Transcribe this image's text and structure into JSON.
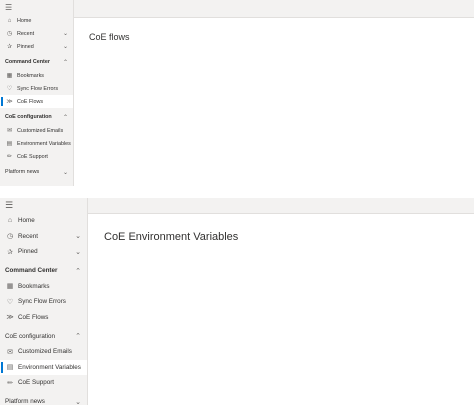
{
  "panels": [
    {
      "title": "CoE flows",
      "nav": {
        "home": "Home",
        "recent": "Recent",
        "pinned": "Pinned",
        "command_center": "Command Center",
        "bookmarks": "Bookmarks",
        "sync_flow_errors": "Sync Flow Errors",
        "coe_flows": "CoE Flows",
        "coe_configuration": "CoE configuration",
        "customized_emails": "Customized Emails",
        "environment_variables": "Environment Variables",
        "coe_support": "CoE Support",
        "platform_news": "Platform news"
      },
      "selected": "CoE Flows"
    },
    {
      "title": "CoE Environment Variables",
      "nav": {
        "home": "Home",
        "recent": "Recent",
        "pinned": "Pinned",
        "command_center": "Command Center",
        "bookmarks": "Bookmarks",
        "sync_flow_errors": "Sync Flow Errors",
        "coe_flows": "CoE Flows",
        "coe_configuration": "CoE configuration",
        "customized_emails": "Customized Emails",
        "environment_variables": "Environment Variables",
        "coe_support": "CoE Support",
        "platform_news": "Platform news"
      },
      "selected": "Environment Variables"
    }
  ],
  "icons": {
    "menu": "hamburger-icon",
    "home": "home-icon",
    "recent": "clock-icon",
    "pinned": "pin-icon",
    "bookmarks": "grid-icon",
    "sync_flow_errors": "heart-icon",
    "coe_flows": "flow-icon",
    "customized_emails": "email-icon",
    "environment_variables": "table-icon",
    "coe_support": "support-icon"
  },
  "colors": {
    "sidebar_bg": "#f3f2f1",
    "selected_accent": "#0078d4",
    "text": "#323130"
  }
}
